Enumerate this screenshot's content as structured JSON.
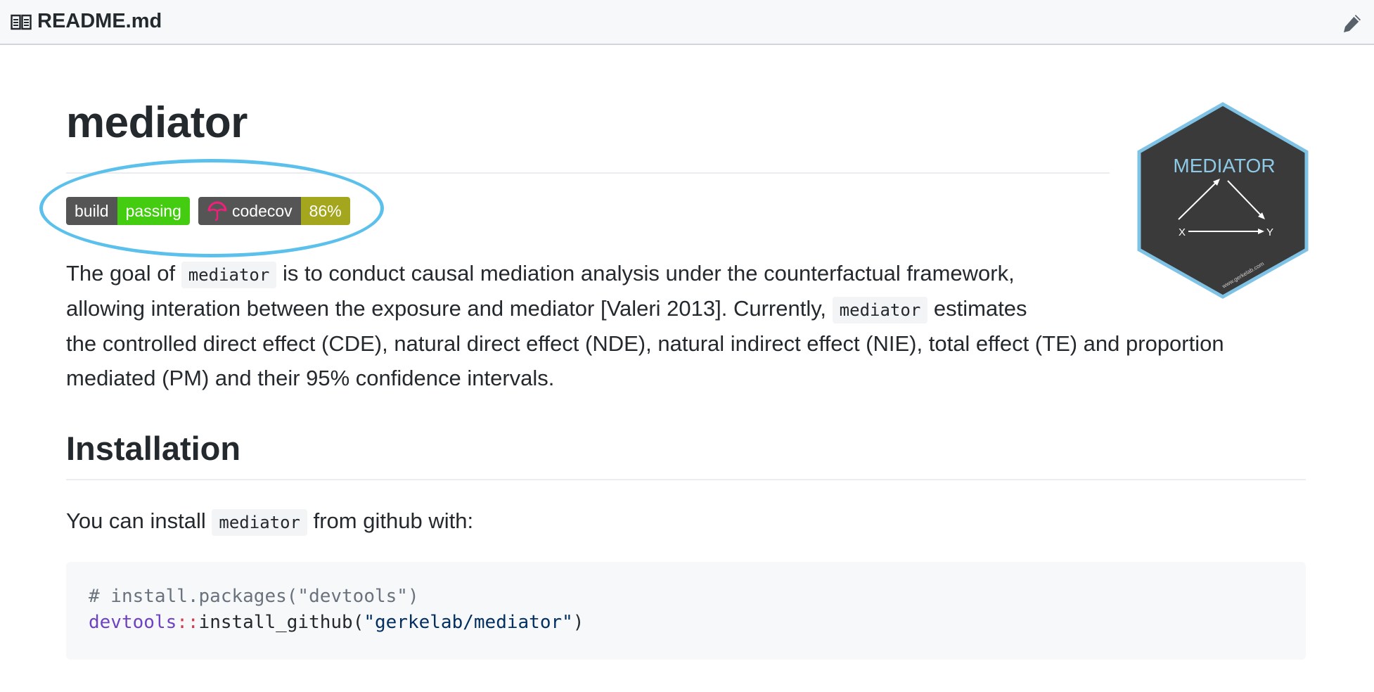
{
  "header": {
    "title": "README.md",
    "icon": "book-icon",
    "edit_icon": "pencil-icon"
  },
  "main": {
    "title": "mediator",
    "badges": {
      "build": {
        "label": "build",
        "value": "passing",
        "color": "#44cc11"
      },
      "codecov": {
        "label": "codecov",
        "value": "86%",
        "color": "#a4a61d",
        "icon": "codecov-umbrella-icon"
      }
    },
    "logo": {
      "title": "MEDIATOR",
      "x_label": "X",
      "y_label": "Y",
      "footer": "www.gerkelab.com",
      "fill": "#3a3a3a",
      "border": "#7ec3e6"
    },
    "intro": {
      "line1_a": "The goal of",
      "line1_code": "mediator",
      "line1_b": "is to conduct causal mediation analysis under the counterfactual framework,",
      "line2_a": "allowing interation between the exposure and mediator [Valeri 2013]. Currently,",
      "line2_code": "mediator",
      "line2_b": "estimates",
      "line3": "the controlled direct effect (CDE), natural direct effect (NDE), natural indirect effect (NIE), total effect (TE) and proportion",
      "line4": "mediated (PM) and their 95% confidence intervals."
    },
    "installation": {
      "heading": "Installation",
      "text_a": "You can install",
      "text_code": "mediator",
      "text_b": "from github with:",
      "code": {
        "comment": "# install.packages(\"devtools\")",
        "ns": "devtools",
        "op": "::",
        "fn": "install_github(",
        "str": "\"gerkelab/mediator\"",
        "close": ")"
      }
    }
  }
}
